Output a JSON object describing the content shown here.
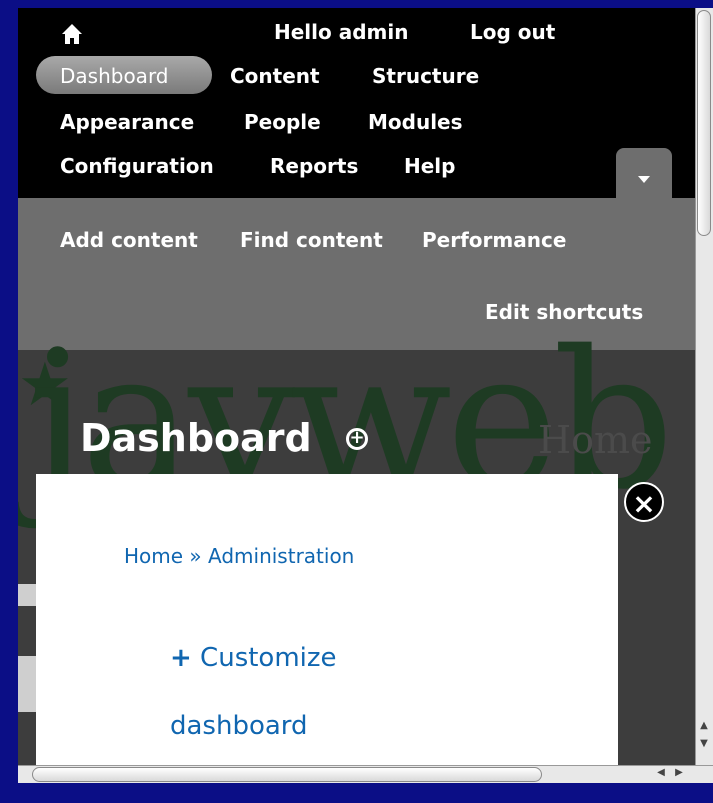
{
  "toolbar": {
    "greeting_prefix": "Hello ",
    "user": "admin",
    "logout_label": "Log out",
    "menu": [
      "Dashboard",
      "Content",
      "Structure",
      "Appearance",
      "People",
      "Modules",
      "Configuration",
      "Reports",
      "Help"
    ],
    "active_item": "Dashboard"
  },
  "shortcuts": {
    "items": [
      "Add content",
      "Find content",
      "Performance"
    ],
    "edit_label": "Edit shortcuts"
  },
  "header": {
    "title": "Dashboard",
    "logo_text": "jayweb",
    "home_text": "Home"
  },
  "overlay": {
    "breadcrumb": "Home » Administration",
    "customize_plus": "+",
    "customize_label": " Customize dashboard"
  },
  "icons": {
    "home": "home-icon",
    "add_shortcut": "plus-circle-icon",
    "close": "close-icon",
    "tray": "chevron-down-icon"
  },
  "colors": {
    "desktop_bg": "#0b0e86",
    "toolbar_bg": "#000000",
    "shortcuts_bg": "#6e6e6e",
    "link_blue": "#1066b0"
  }
}
